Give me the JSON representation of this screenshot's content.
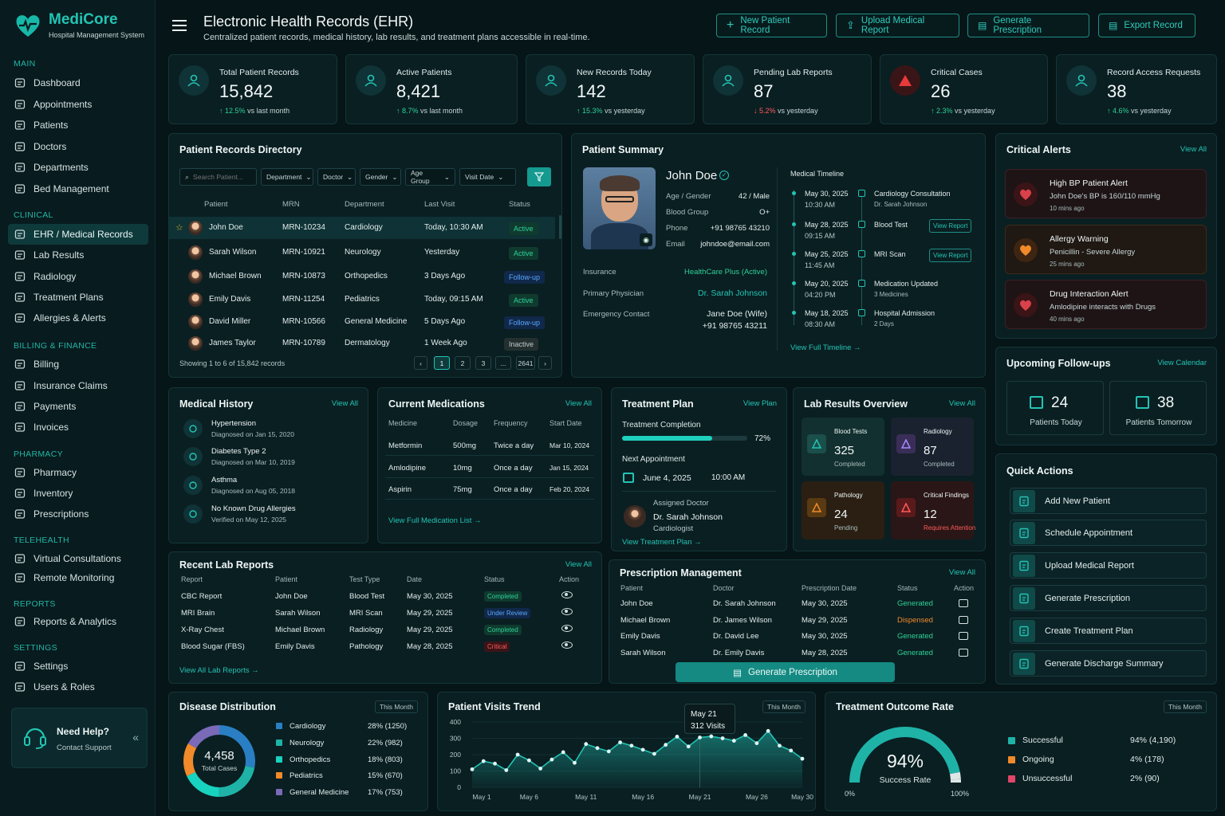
{
  "brand": {
    "name": "MediCore",
    "tagline": "Hospital Management System"
  },
  "nav": {
    "main": "MAIN",
    "clinical": "CLINICAL",
    "billing": "BILLING & FINANCE",
    "pharmacy": "PHARMACY",
    "telehealth": "TELEHEALTH",
    "reports": "REPORTS",
    "settings": "SETTINGS",
    "items": [
      "Dashboard",
      "Appointments",
      "Patients",
      "Doctors",
      "Departments",
      "Bed Management",
      "EHR / Medical Records",
      "Lab Results",
      "Radiology",
      "Treatment Plans",
      "Allergies & Alerts",
      "Billing",
      "Insurance Claims",
      "Payments",
      "Invoices",
      "Pharmacy",
      "Inventory",
      "Prescriptions",
      "Virtual Consultations",
      "Remote Monitoring",
      "Reports & Analytics",
      "Settings",
      "Users & Roles"
    ]
  },
  "help": {
    "title": "Need Help?",
    "sub": "Contact Support"
  },
  "header": {
    "title": "Electronic Health Records (EHR)",
    "subtitle": "Centralized patient records, medical history, lab results, and treatment plans accessible in real-time.",
    "buttons": [
      "New Patient Record",
      "Upload Medical Report",
      "Generate Prescription",
      "Export Record"
    ]
  },
  "stats": [
    {
      "label": "Total Patient Records",
      "value": "15,842",
      "pct": "12.5%",
      "suffix": "vs last month",
      "dir": "up"
    },
    {
      "label": "Active Patients",
      "value": "8,421",
      "pct": "8.7%",
      "suffix": "vs last month",
      "dir": "up"
    },
    {
      "label": "New Records Today",
      "value": "142",
      "pct": "15.3%",
      "suffix": "vs yesterday",
      "dir": "up"
    },
    {
      "label": "Pending Lab Reports",
      "value": "87",
      "pct": "5.2%",
      "suffix": "vs yesterday",
      "dir": "dn"
    },
    {
      "label": "Critical Cases",
      "value": "26",
      "pct": "2.3%",
      "suffix": "vs yesterday",
      "dir": "up"
    },
    {
      "label": "Record Access Requests",
      "value": "38",
      "pct": "4.6%",
      "suffix": "vs yesterday",
      "dir": "up"
    }
  ],
  "directory": {
    "title": "Patient Records Directory",
    "search_placeholder": "Search Patient...",
    "filters": [
      "Department",
      "Doctor",
      "Gender",
      "Age Group",
      "Visit Date"
    ],
    "cols": [
      "Patient",
      "MRN",
      "Department",
      "Last Visit",
      "Status"
    ],
    "rows": [
      [
        "John Doe",
        "MRN-10234",
        "Cardiology",
        "Today, 10:30 AM",
        "Active"
      ],
      [
        "Sarah Wilson",
        "MRN-10921",
        "Neurology",
        "Yesterday",
        "Active"
      ],
      [
        "Michael Brown",
        "MRN-10873",
        "Orthopedics",
        "3 Days Ago",
        "Follow-up"
      ],
      [
        "Emily Davis",
        "MRN-11254",
        "Pediatrics",
        "Today, 09:15 AM",
        "Active"
      ],
      [
        "David Miller",
        "MRN-10566",
        "General Medicine",
        "5 Days Ago",
        "Follow-up"
      ],
      [
        "James Taylor",
        "MRN-10789",
        "Dermatology",
        "1 Week Ago",
        "Inactive"
      ]
    ],
    "showing": "Showing 1 to 6 of 15,842 records",
    "pages": [
      "‹",
      "1",
      "2",
      "3",
      "...",
      "2641",
      "›"
    ]
  },
  "summary": {
    "title": "Patient Summary",
    "name": "John Doe",
    "fields": [
      [
        "Age / Gender",
        "42 / Male"
      ],
      [
        "Blood Group",
        "O+"
      ],
      [
        "Phone",
        "+91 98765 43210"
      ],
      [
        "Email",
        "johndoe@email.com"
      ]
    ],
    "insurance_label": "Insurance",
    "insurance": "HealthCare Plus (Active)",
    "physician_label": "Primary Physician",
    "physician": "Dr. Sarah Johnson",
    "emergency_label": "Emergency Contact",
    "emergency1": "Jane Doe (Wife)",
    "emergency2": "+91 98765 43211",
    "timeline_title": "Medical Timeline",
    "timeline": [
      {
        "date": "May 30, 2025",
        "time": "10:30 AM",
        "event": "Cardiology Consultation",
        "sub": "Dr. Sarah Johnson",
        "link": ""
      },
      {
        "date": "May 28, 2025",
        "time": "09:15 AM",
        "event": "Blood Test",
        "sub": "",
        "link": "View Report"
      },
      {
        "date": "May 25, 2025",
        "time": "11:45 AM",
        "event": "MRI Scan",
        "sub": "",
        "link": "View Report"
      },
      {
        "date": "May 20, 2025",
        "time": "04:20 PM",
        "event": "Medication Updated",
        "sub": "3 Medicines",
        "link": ""
      },
      {
        "date": "May 18, 2025",
        "time": "08:30 AM",
        "event": "Hospital Admission",
        "sub": "2 Days",
        "link": ""
      }
    ],
    "timeline_link": "View Full Timeline"
  },
  "alerts": {
    "title": "Critical Alerts",
    "view": "View All",
    "items": [
      {
        "title": "High BP Patient Alert",
        "desc": "John Doe's BP is 160/110 mmHg",
        "time": "10 mins ago"
      },
      {
        "title": "Allergy Warning",
        "desc": "Penicillin - Severe Allergy",
        "time": "25 mins ago"
      },
      {
        "title": "Drug Interaction Alert",
        "desc": "Amlodipine interacts with Drugs",
        "time": "40 mins ago"
      }
    ]
  },
  "followups": {
    "title": "Upcoming Follow-ups",
    "view": "View Calendar",
    "today": "24",
    "today_label": "Patients Today",
    "tomorrow": "38",
    "tomorrow_label": "Patients Tomorrow"
  },
  "quick": {
    "title": "Quick Actions",
    "items": [
      "Add New Patient",
      "Schedule Appointment",
      "Upload Medical Report",
      "Generate Prescription",
      "Create Treatment Plan",
      "Generate Discharge Summary"
    ]
  },
  "history": {
    "title": "Medical History",
    "view": "View All",
    "items": [
      {
        "name": "Hypertension",
        "sub": "Diagnosed on Jan 15, 2020"
      },
      {
        "name": "Diabetes Type 2",
        "sub": "Diagnosed on Mar 10, 2019"
      },
      {
        "name": "Asthma",
        "sub": "Diagnosed on Aug 05, 2018"
      },
      {
        "name": "No Known Drug Allergies",
        "sub": "Verified on May 12, 2025"
      }
    ]
  },
  "meds": {
    "title": "Current Medications",
    "view": "View All",
    "cols": [
      "Medicine",
      "Dosage",
      "Frequency",
      "Start Date"
    ],
    "rows": [
      [
        "Metformin",
        "500mg",
        "Twice a day",
        "Mar 10, 2024"
      ],
      [
        "Amlodipine",
        "10mg",
        "Once a day",
        "Jan 15, 2024"
      ],
      [
        "Aspirin",
        "75mg",
        "Once a day",
        "Feb 20, 2024"
      ]
    ],
    "link": "View Full Medication List"
  },
  "plan": {
    "title": "Treatment Plan",
    "view": "View Plan",
    "completion_label": "Treatment Completion",
    "completion": 72,
    "completion_text": "72%",
    "next_label": "Next Appointment",
    "next_date": "June 4, 2025",
    "next_time": "10:00 AM",
    "doctor_label": "Assigned Doctor",
    "doctor": "Dr. Sarah Johnson",
    "role": "Cardiologist",
    "link": "View Treatment Plan"
  },
  "labs": {
    "title": "Lab Results Overview",
    "view": "View All",
    "tiles": [
      {
        "name": "Blood Tests",
        "value": "325",
        "sub": "Completed"
      },
      {
        "name": "Radiology",
        "value": "87",
        "sub": "Completed"
      },
      {
        "name": "Pathology",
        "value": "24",
        "sub": "Pending"
      },
      {
        "name": "Critical Findings",
        "value": "12",
        "sub": "Requires Attention"
      }
    ]
  },
  "reports": {
    "title": "Recent Lab Reports",
    "view": "View All",
    "cols": [
      "Report",
      "Patient",
      "Test Type",
      "Date",
      "Status",
      "Action"
    ],
    "rows": [
      [
        "CBC Report",
        "John Doe",
        "Blood Test",
        "May 30, 2025",
        "Completed"
      ],
      [
        "MRI Brain",
        "Sarah Wilson",
        "MRI Scan",
        "May 29, 2025",
        "Under Review"
      ],
      [
        "X-Ray Chest",
        "Michael Brown",
        "Radiology",
        "May 29, 2025",
        "Completed"
      ],
      [
        "Blood Sugar (FBS)",
        "Emily Davis",
        "Pathology",
        "May 28, 2025",
        "Critical"
      ]
    ],
    "link": "View All Lab Reports"
  },
  "rx": {
    "title": "Prescription Management",
    "view": "View All",
    "cols": [
      "Patient",
      "Doctor",
      "Prescription Date",
      "Status",
      "Action"
    ],
    "rows": [
      [
        "John Doe",
        "Dr. Sarah Johnson",
        "May 30, 2025",
        "Generated"
      ],
      [
        "Michael Brown",
        "Dr. James Wilson",
        "May 29, 2025",
        "Dispensed"
      ],
      [
        "Emily Davis",
        "Dr. David Lee",
        "May 30, 2025",
        "Generated"
      ],
      [
        "Sarah Wilson",
        "Dr. Emily Davis",
        "May 28, 2025",
        "Generated"
      ]
    ],
    "button": "Generate Prescription"
  },
  "disease": {
    "title": "Disease Distribution",
    "period": "This Month",
    "total": "4,458",
    "total_label": "Total Cases"
  },
  "visits": {
    "title": "Patient Visits Trend",
    "period": "This Month",
    "tooltip_date": "May 21",
    "tooltip_val": "312 Visits"
  },
  "outcome": {
    "title": "Treatment Outcome Rate",
    "period": "This Month",
    "rate": "94%",
    "rate_label": "Success Rate",
    "min": "0%",
    "max": "100%"
  },
  "chart_data": [
    {
      "type": "pie",
      "title": "Disease Distribution",
      "categories": [
        "Cardiology",
        "Neurology",
        "Orthopedics",
        "Pediatrics",
        "General Medicine"
      ],
      "values": [
        1250,
        982,
        803,
        670,
        753
      ],
      "pct_labels": [
        "28% (1250)",
        "22% (982)",
        "18% (803)",
        "15% (670)",
        "17% (753)"
      ],
      "colors": [
        "#2a7fc4",
        "#1fb3a8",
        "#18d3c0",
        "#f08a2a",
        "#7a6ab8"
      ]
    },
    {
      "type": "area",
      "title": "Patient Visits Trend",
      "x": [
        "May 1",
        "May 2",
        "May 3",
        "May 4",
        "May 5",
        "May 6",
        "May 7",
        "May 8",
        "May 9",
        "May 10",
        "May 11",
        "May 12",
        "May 13",
        "May 14",
        "May 15",
        "May 16",
        "May 17",
        "May 18",
        "May 19",
        "May 20",
        "May 21",
        "May 22",
        "May 23",
        "May 24",
        "May 25",
        "May 26",
        "May 27",
        "May 28",
        "May 29",
        "May 30"
      ],
      "values": [
        110,
        160,
        145,
        105,
        200,
        165,
        115,
        170,
        215,
        150,
        265,
        240,
        220,
        275,
        255,
        230,
        205,
        260,
        310,
        250,
        305,
        312,
        300,
        285,
        320,
        270,
        345,
        255,
        225,
        175
      ],
      "x_ticks": [
        "May 1",
        "May 6",
        "May 11",
        "May 16",
        "May 21",
        "May 26",
        "May 30"
      ],
      "ylim": [
        0,
        400
      ],
      "y_ticks": [
        0,
        100,
        200,
        300,
        400
      ]
    },
    {
      "type": "pie",
      "title": "Treatment Outcome Rate",
      "categories": [
        "Successful",
        "Ongoing",
        "Unsuccessful"
      ],
      "values": [
        4190,
        178,
        90
      ],
      "labels": [
        "94% (4,190)",
        "4% (178)",
        "2% (90)"
      ],
      "colors": [
        "#1fb3a8",
        "#f08a2a",
        "#e0456a"
      ]
    }
  ]
}
